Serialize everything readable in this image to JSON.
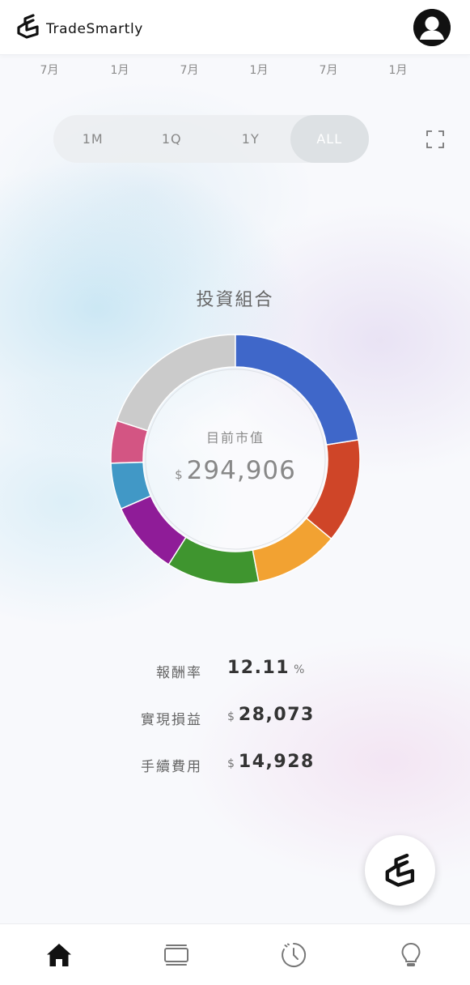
{
  "header": {
    "brand_name": "TradeSmartly",
    "logo_icon": "tradesmartly-logo-icon",
    "avatar_icon": "user-avatar-icon"
  },
  "month_axis": [
    "7月",
    "1月",
    "7月",
    "1月",
    "7月",
    "1月"
  ],
  "range_selector": {
    "options": [
      "1M",
      "1Q",
      "1Y",
      "ALL"
    ],
    "selected": "ALL"
  },
  "fullscreen_icon": "fullscreen-icon",
  "portfolio": {
    "title": "投資組合",
    "center_label": "目前市值",
    "currency": "$",
    "market_value": "294,906"
  },
  "chart_data": {
    "type": "pie",
    "donut": true,
    "values": [
      22.5,
      13.5,
      11.0,
      12.0,
      9.5,
      6.0,
      5.5,
      20.0
    ],
    "colors": [
      "#3f67c9",
      "#cf4528",
      "#f2a232",
      "#3f952f",
      "#8f1c98",
      "#4198c6",
      "#d35583",
      "#cbcbcb"
    ]
  },
  "stats": [
    {
      "label": "報酬率",
      "currency": "",
      "value": "12.11",
      "unit": "%"
    },
    {
      "label": "實現損益",
      "currency": "$",
      "value": "28,073",
      "unit": ""
    },
    {
      "label": "手續費用",
      "currency": "$",
      "value": "14,928",
      "unit": ""
    }
  ],
  "fab_icon": "tradesmartly-logo-icon",
  "bottom_nav": [
    "home-icon",
    "cards-icon",
    "history-icon",
    "lightbulb-icon"
  ]
}
